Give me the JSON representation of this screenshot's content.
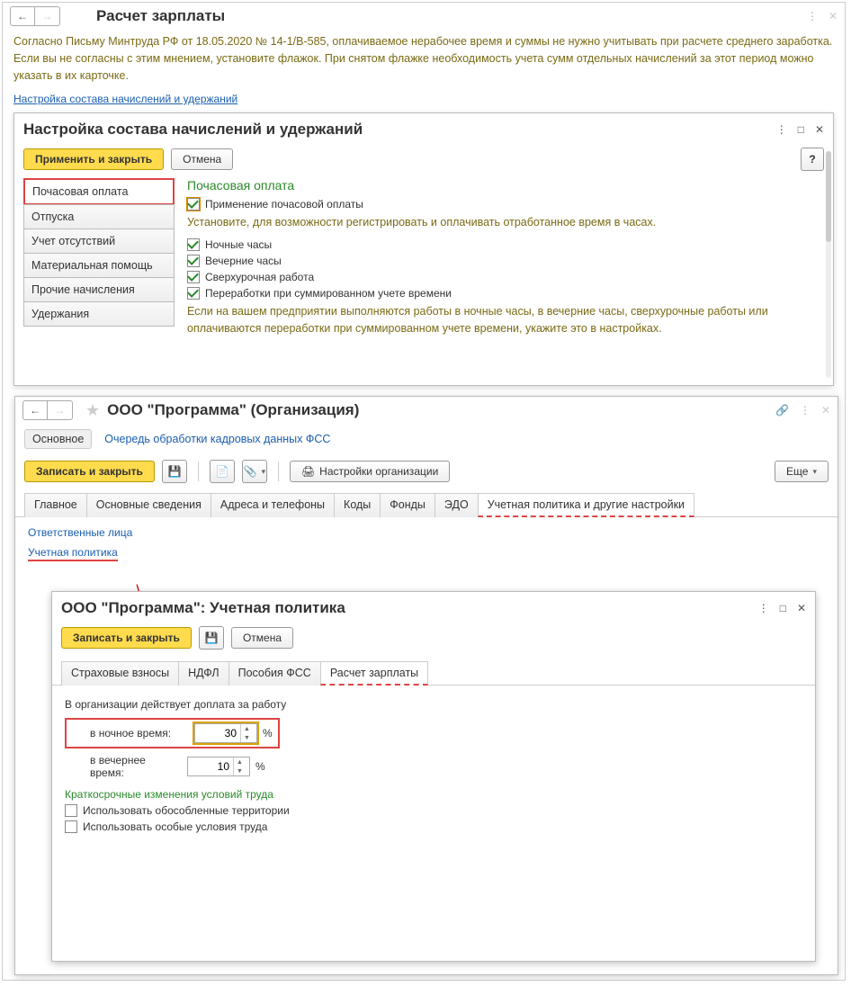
{
  "outer": {
    "title": "Расчет зарплаты",
    "info": "Согласно Письму Минтруда РФ от 18.05.2020 № 14-1/В-585, оплачиваемое нерабочее время и суммы не нужно учитывать при расчете среднего заработка. Если вы не согласны с этим мнением, установите флажок. При снятом флажке необходимость учета сумм отдельных начислений за этот период можно указать в их карточке.",
    "link": "Настройка состава начислений и удержаний"
  },
  "config": {
    "title": "Настройка состава начислений и удержаний",
    "apply": "Применить и закрыть",
    "cancel": "Отмена",
    "help": "?",
    "tabs": [
      "Почасовая оплата",
      "Отпуска",
      "Учет отсутствий",
      "Материальная помощь",
      "Прочие начисления",
      "Удержания"
    ],
    "content": {
      "heading": "Почасовая оплата",
      "chk1": "Применение почасовой оплаты",
      "help1": "Установите, для возможности регистрировать и оплачивать отработанное время в часах.",
      "chk2": "Ночные часы",
      "chk3": "Вечерние часы",
      "chk4": "Сверхурочная работа",
      "chk5": "Переработки при суммированном учете времени",
      "help2": "Если на вашем предприятии выполняются работы в ночные часы, в вечерние часы, сверхурочные работы или оплачиваются переработки при суммированном учете времени, укажите это в настройках."
    }
  },
  "org": {
    "title": "ООО \"Программа\" (Организация)",
    "main": "Основное",
    "queue": "Очередь обработки кадровых данных ФСС",
    "save": "Записать и закрыть",
    "print": "Настройки организации",
    "more": "Еще",
    "tabs": [
      "Главное",
      "Основные сведения",
      "Адреса и телефоны",
      "Коды",
      "Фонды",
      "ЭДО",
      "Учетная политика и другие настройки"
    ],
    "links": {
      "resp": "Ответственные лица",
      "policy": "Учетная политика"
    }
  },
  "policy": {
    "title": "ООО \"Программа\": Учетная политика",
    "save": "Записать и закрыть",
    "cancel": "Отмена",
    "tabs": [
      "Страховые взносы",
      "НДФЛ",
      "Пособия ФСС",
      "Расчет зарплаты"
    ],
    "body": {
      "intro": "В организации действует доплата за работу",
      "night_label": "в ночное время:",
      "night_value": "30",
      "evening_label": "в вечернее время:",
      "evening_value": "10",
      "percent": "%",
      "section": "Краткосрочные изменения условий труда",
      "opt1": "Использовать обособленные территории",
      "opt2": "Использовать особые условия труда"
    }
  }
}
